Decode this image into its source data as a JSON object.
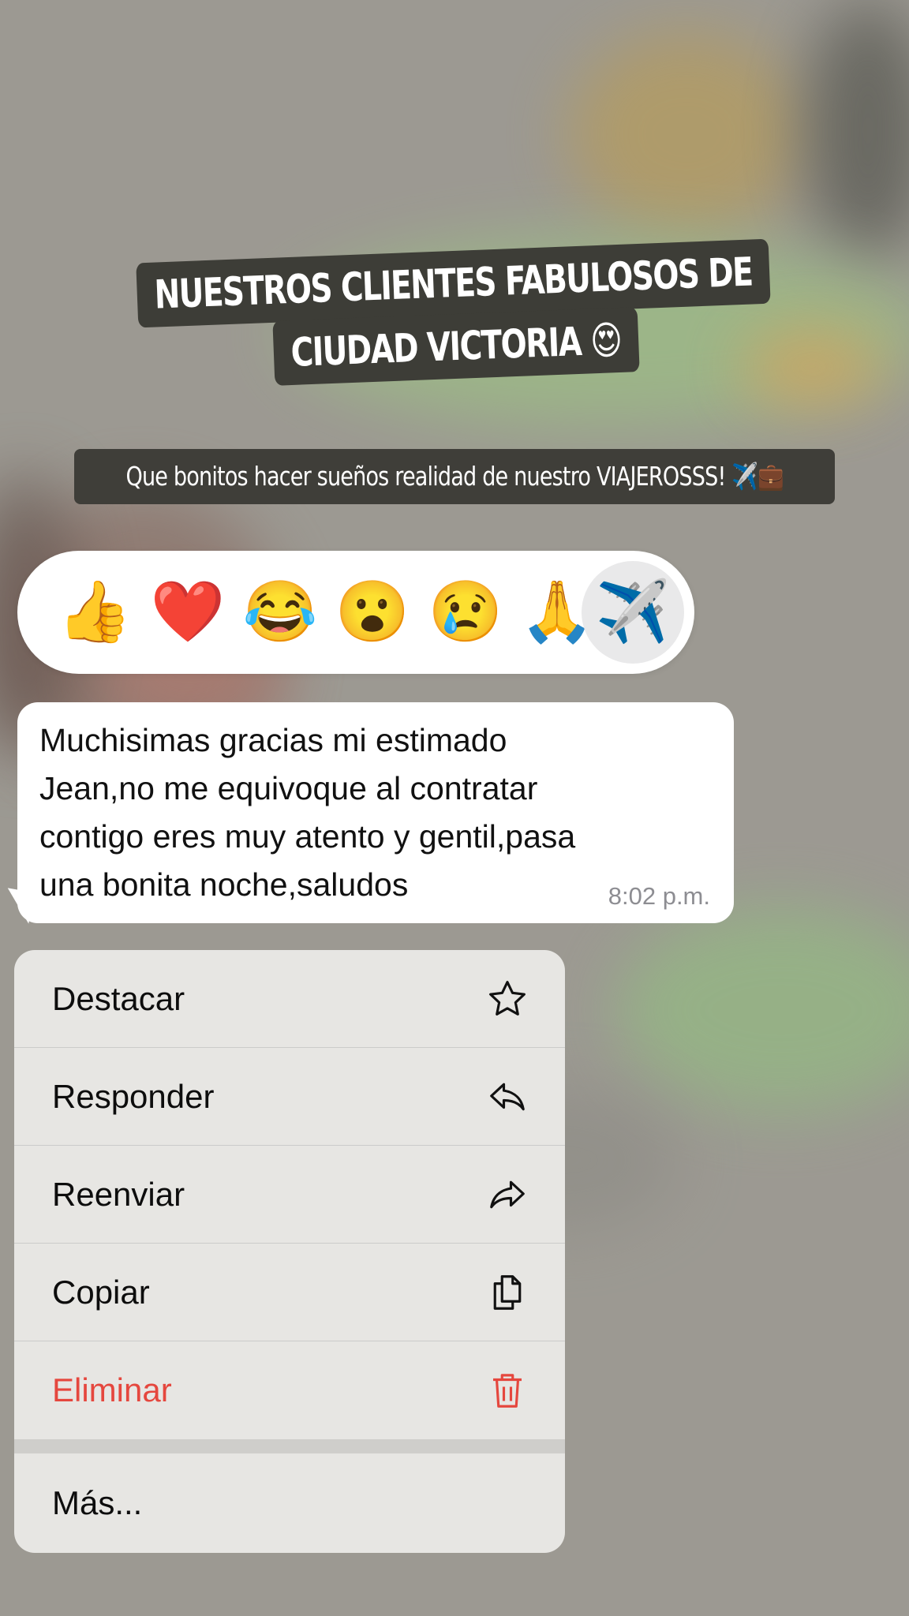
{
  "story": {
    "title_lines": [
      "NUESTROS CLIENTES FABULOSOS DE",
      "CIUDAD VICTORIA 😍"
    ],
    "subtitle": "Que bonitos hacer sueños realidad de nuestro VIAJEROSSS! ✈️💼"
  },
  "reactions": [
    {
      "emoji": "👍",
      "icon": "thumbs-up"
    },
    {
      "emoji": "❤️",
      "icon": "red-heart"
    },
    {
      "emoji": "😂",
      "icon": "tears-of-joy"
    },
    {
      "emoji": "😮",
      "icon": "open-mouth"
    },
    {
      "emoji": "😢",
      "icon": "crying-face"
    },
    {
      "emoji": "🙏",
      "icon": "folded-hands"
    },
    {
      "emoji": "✈️",
      "icon": "airplane",
      "selected": true
    }
  ],
  "message": {
    "lines": [
      "Muchisimas gracias mi estimado",
      "Jean,no me equivoque al contratar",
      "contigo eres muy atento y gentil,pasa",
      "una bonita noche,saludos"
    ],
    "time": "8:02 p.m."
  },
  "menu": {
    "items": [
      {
        "label": "Destacar",
        "icon": "star-icon"
      },
      {
        "label": "Responder",
        "icon": "reply-icon"
      },
      {
        "label": "Reenviar",
        "icon": "forward-icon"
      },
      {
        "label": "Copiar",
        "icon": "copy-icon"
      },
      {
        "label": "Eliminar",
        "icon": "trash-icon",
        "color": "#e5473e"
      }
    ],
    "more": "Más..."
  }
}
